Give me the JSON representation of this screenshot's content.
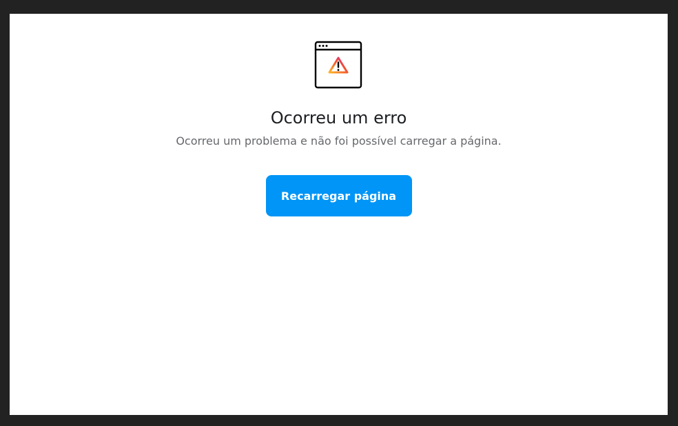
{
  "error_page": {
    "icon": "browser-window-warning-icon",
    "title": "Ocorreu um erro",
    "message": "Ocorreu um problema e não foi possível carregar a página.",
    "reload_label": "Recarregar página"
  },
  "colors": {
    "background_frame": "#222222",
    "page_background": "#ffffff",
    "title_text": "#1c1e21",
    "message_text": "#65676b",
    "button_background": "#0095f6",
    "button_text": "#ffffff",
    "warning_gradient_start": "#fdb42a",
    "warning_gradient_end": "#d6249f"
  }
}
